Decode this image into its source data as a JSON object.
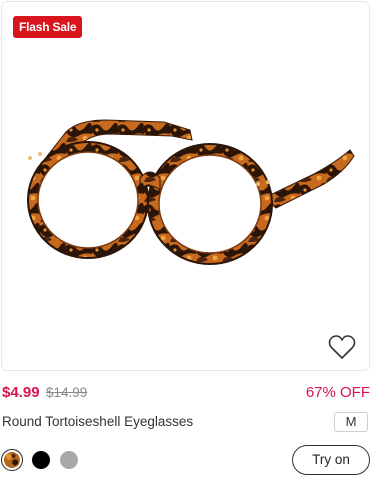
{
  "badge": {
    "label": "Flash Sale",
    "color": "#d8141c"
  },
  "product": {
    "title": "Round Tortoiseshell Eyeglasses",
    "price": "$4.99",
    "original_price": "$14.99",
    "discount": "67% OFF",
    "size": "M",
    "image_icon": "tortoiseshell-round-glasses",
    "accent_color": "#d8144c"
  },
  "wishlist": {
    "icon": "heart-outline-icon"
  },
  "swatches": [
    {
      "name": "tortoiseshell",
      "color": "#b5651d",
      "selected": true
    },
    {
      "name": "black",
      "color": "#000000",
      "selected": false
    },
    {
      "name": "gray",
      "color": "#a8a8a8",
      "selected": false
    }
  ],
  "actions": {
    "try_on_label": "Try on"
  }
}
